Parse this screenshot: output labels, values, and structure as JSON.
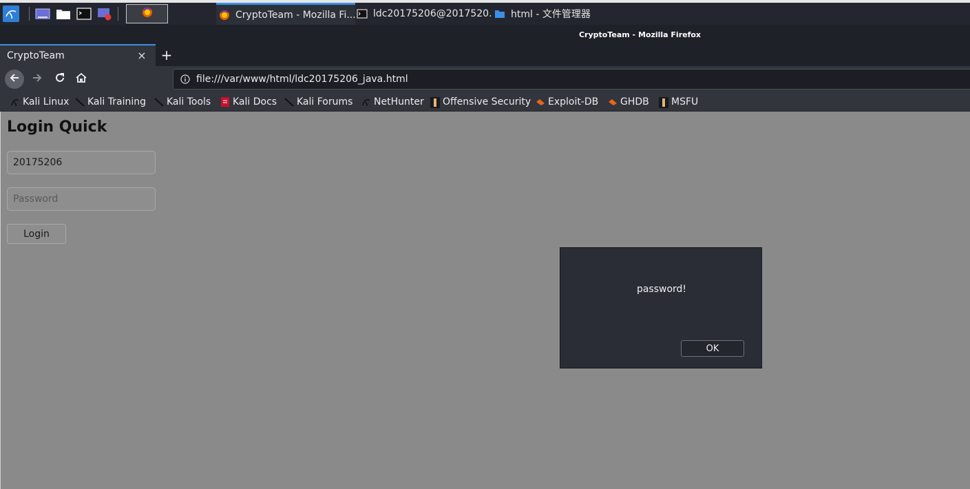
{
  "taskbar": {
    "windows": [
      {
        "label": "CryptoTeam - Mozilla Fi..."
      },
      {
        "label": "ldc20175206@2017520..."
      },
      {
        "label": "html - 文件管理器"
      }
    ]
  },
  "window": {
    "title": "CryptoTeam - Mozilla Firefox"
  },
  "tab": {
    "label": "CryptoTeam",
    "close": "×",
    "new": "+"
  },
  "urlbar": {
    "value": "file:///var/www/html/ldc20175206_java.html"
  },
  "bookmarks": [
    {
      "label": "Kali Linux"
    },
    {
      "label": "Kali Training"
    },
    {
      "label": "Kali Tools"
    },
    {
      "label": "Kali Docs"
    },
    {
      "label": "Kali Forums"
    },
    {
      "label": "NetHunter"
    },
    {
      "label": "Offensive Security"
    },
    {
      "label": "Exploit-DB"
    },
    {
      "label": "GHDB"
    },
    {
      "label": "MSFU"
    }
  ],
  "page": {
    "title": "Login Quick",
    "username_value": "20175206",
    "password_placeholder": "Password",
    "login_label": "Login"
  },
  "alert": {
    "message": "password!",
    "ok_label": "OK"
  },
  "colors": {
    "accent": "#3d8fe6",
    "page_bg": "#8a8a8a",
    "dialog_bg": "#2a2d35"
  }
}
